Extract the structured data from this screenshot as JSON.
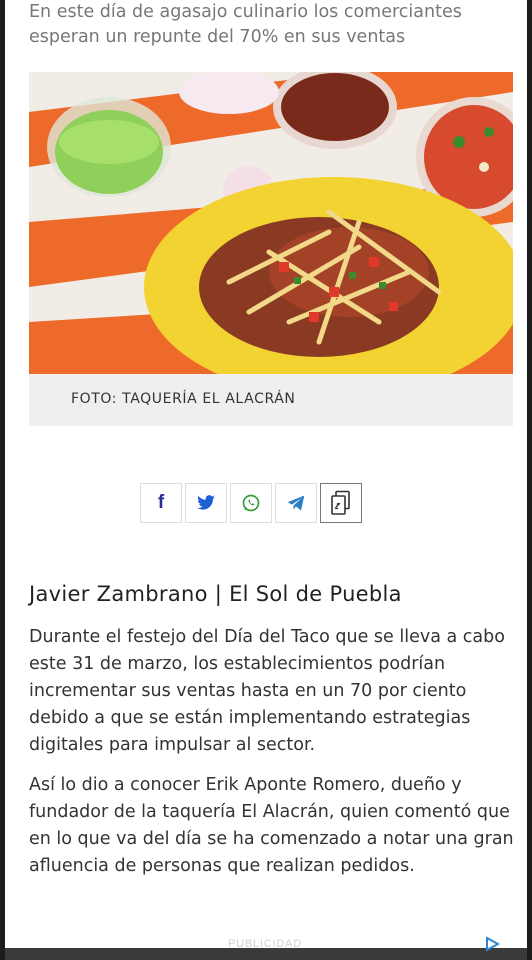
{
  "article": {
    "subtitle": "En este día de agasajo culinario los comerciantes esperan un repunte del 70% en sus ventas",
    "photo_caption": "FOTO: TAQUERÍA EL ALACRÁN",
    "byline": "Javier Zambrano | El Sol de Puebla",
    "paragraphs": [
      "Durante el festejo del Día del Taco que se lleva a cabo este 31 de marzo, los establecimientos podrían incrementar sus ventas hasta en un 70 por ciento debido a que se están implementando estrategias digitales para impulsar al sector.",
      "Así lo dio a conocer Erik Aponte Romero, dueño y fundador de la taquería El Alacrán, quien comentó que en lo que va del día se ha comenzado a notar una gran afluencia de personas que realizan pedidos."
    ]
  },
  "share": {
    "buttons": [
      {
        "icon": "facebook-icon",
        "label": "f"
      },
      {
        "icon": "twitter-icon"
      },
      {
        "icon": "whatsapp-icon"
      },
      {
        "icon": "telegram-icon"
      },
      {
        "icon": "copy-link-icon"
      }
    ]
  },
  "ad": {
    "label": "PUBLICIDAD",
    "icon": "adchoices-icon"
  },
  "colors": {
    "facebook": "#2c2c9a",
    "twitter": "#1d5fd6",
    "whatsapp": "#2e9e3a",
    "telegram": "#2a7fc4"
  }
}
